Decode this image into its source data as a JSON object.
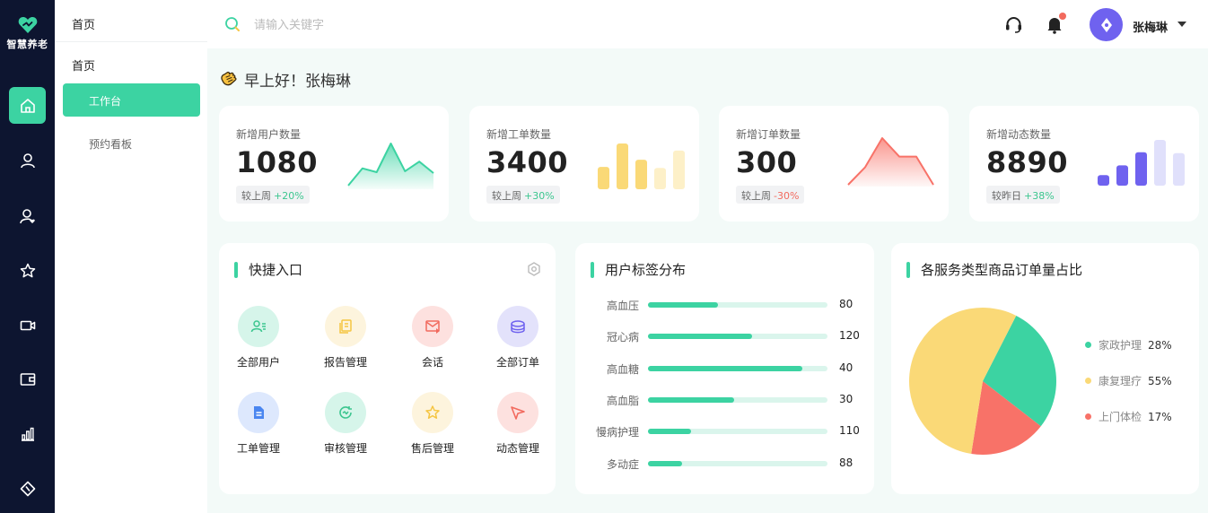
{
  "app": {
    "logo_text": "智慧养老"
  },
  "rail": {
    "icons": [
      "home-icon",
      "user-icon",
      "user-heart-icon",
      "star-icon",
      "video-icon",
      "wallet-icon",
      "bar-chart-icon",
      "shortcut-icon"
    ]
  },
  "submenu": {
    "top_title": "首页",
    "group": "首页",
    "items": [
      {
        "label": "工作台"
      },
      {
        "label": "预约看板"
      }
    ]
  },
  "topbar": {
    "search_placeholder": "请输入关键字",
    "user_name": "张梅琳"
  },
  "greeting": "早上好！张梅琳",
  "stats": [
    {
      "label": "新增用户数量",
      "value": "1080",
      "compare_label": "较上周",
      "change": "+20%",
      "trend": "up",
      "chart": "area-green",
      "spark": [
        2,
        20,
        16,
        46,
        17,
        27,
        15
      ]
    },
    {
      "label": "新增工单数量",
      "value": "3400",
      "compare_label": "较上周",
      "change": "+30%",
      "trend": "up",
      "chart": "bars-yellow",
      "spark": [
        22,
        45,
        29,
        21,
        38
      ]
    },
    {
      "label": "新增订单数量",
      "value": "300",
      "compare_label": "较上周",
      "change": "-30%",
      "trend": "down",
      "chart": "area-red",
      "spark": [
        0,
        20,
        53,
        32,
        32,
        0
      ]
    },
    {
      "label": "新增动态数量",
      "value": "8890",
      "compare_label": "较昨日",
      "change": "+38%",
      "trend": "up",
      "chart": "bars-purple",
      "spark": [
        12,
        23,
        38,
        52,
        37
      ]
    }
  ],
  "quick": {
    "title": "快捷入口",
    "items": [
      {
        "label": "全部用户",
        "icon": "users-icon",
        "bg": "#d6f5ea",
        "fg": "#3cc68f"
      },
      {
        "label": "报告管理",
        "icon": "report-icon",
        "bg": "#fdf4dd",
        "fg": "#f5c542"
      },
      {
        "label": "会话",
        "icon": "chat-mail-icon",
        "bg": "#fde1df",
        "fg": "#f26a5e"
      },
      {
        "label": "全部订单",
        "icon": "coins-icon",
        "bg": "#e3e2fb",
        "fg": "#6f62ef"
      },
      {
        "label": "工单管理",
        "icon": "document-icon",
        "bg": "#dde8fd",
        "fg": "#4a86f0"
      },
      {
        "label": "审核管理",
        "icon": "review-icon",
        "bg": "#d6f5ea",
        "fg": "#3cc68f"
      },
      {
        "label": "售后管理",
        "icon": "after-sale-icon",
        "bg": "#fdf4dd",
        "fg": "#f5c542"
      },
      {
        "label": "动态管理",
        "icon": "send-icon",
        "bg": "#fde1df",
        "fg": "#f26a5e"
      }
    ]
  },
  "tags": {
    "title": "用户标签分布",
    "rows": [
      {
        "name": "高血压",
        "value": "80",
        "fill": 0.39
      },
      {
        "name": "冠心病",
        "value": "120",
        "fill": 0.58
      },
      {
        "name": "高血糖",
        "value": "40",
        "fill": 0.86
      },
      {
        "name": "高血脂",
        "value": "30",
        "fill": 0.48
      },
      {
        "name": "慢病护理",
        "value": "110",
        "fill": 0.24
      },
      {
        "name": "多动症",
        "value": "88",
        "fill": 0.19
      }
    ]
  },
  "chart_data": {
    "type": "pie",
    "title": "各服务类型商品订单量占比",
    "slices": [
      {
        "name": "家政护理",
        "value": 28,
        "label": "28%",
        "color": "#3cd3a2"
      },
      {
        "name": "康复理疗",
        "value": 55,
        "label": "55%",
        "color": "#fad977"
      },
      {
        "name": "上门体检",
        "value": 17,
        "label": "17%",
        "color": "#f87268"
      }
    ]
  }
}
